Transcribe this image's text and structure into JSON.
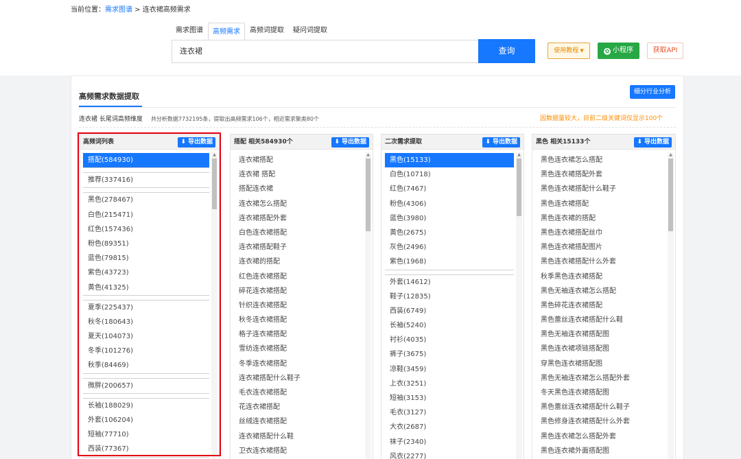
{
  "breadcrumb": {
    "prefix": "当前位置：",
    "link": "需求图谱",
    "sep": " > ",
    "current": "连衣裙高频需求"
  },
  "tabs": [
    "需求图谱",
    "高频需求",
    "高频词提取",
    "疑问词提取"
  ],
  "active_tab": 1,
  "search": {
    "value": "连衣裙",
    "button": "查询"
  },
  "actions": {
    "tutorial": "使用教程",
    "mini_program": "小程序",
    "api": "获取API"
  },
  "panel": {
    "title": "高频需求数据提取",
    "industry_button": "细分行业分析",
    "summary_left": "连衣裙 长尾词高频维度",
    "summary_stats": "共分析数据7732195条，提取出高频需求106个，相近需求聚类80个",
    "summary_right": "因数据量较大，目前二级关键词仅显示100个",
    "export_label": "导出数据"
  },
  "columns": [
    {
      "header": "高频词列表",
      "groups": [
        [
          "搭配(584930)"
        ],
        [
          "推荐(337416)"
        ],
        [
          "黑色(278467)",
          "白色(215471)",
          "红色(157436)",
          "粉色(89351)",
          "蓝色(79815)",
          "紫色(43723)",
          "黄色(41325)"
        ],
        [
          "夏季(225437)",
          "秋冬(180643)",
          "夏天(104073)",
          "冬季(101276)",
          "秋季(84469)"
        ],
        [
          "微胖(200657)"
        ],
        [
          "长袖(188029)",
          "外套(106204)",
          "短袖(77710)",
          "西装(77367)"
        ]
      ]
    },
    {
      "header": "搭配 相关584930个",
      "items": [
        "连衣裙搭配",
        "连衣裙 搭配",
        "搭配连衣裙",
        "连衣裙怎么搭配",
        "连衣裙搭配外套",
        "白色连衣裙搭配",
        "连衣裙搭配鞋子",
        "连衣裙的搭配",
        "红色连衣裙搭配",
        "碎花连衣裙搭配",
        "针织连衣裙搭配",
        "秋冬连衣裙搭配",
        "格子连衣裙搭配",
        "雪纺连衣裙搭配",
        "冬季连衣裙搭配",
        "连衣裙搭配什么鞋子",
        "毛衣连衣裙搭配",
        "花连衣裙搭配",
        "丝绒连衣裙搭配",
        "连衣裙搭配什么鞋",
        "卫衣连衣裙搭配"
      ]
    },
    {
      "header": "二次需求提取",
      "groups": [
        [
          "黑色(15133)",
          "白色(10718)",
          "红色(7467)",
          "粉色(4306)",
          "蓝色(3980)",
          "黄色(2675)",
          "灰色(2496)",
          "紫色(1968)"
        ],
        [
          "外套(14612)",
          "鞋子(12835)",
          "西装(6749)",
          "长袖(5240)",
          "衬衫(4035)",
          "裤子(3675)",
          "凉鞋(3459)",
          "上衣(3251)",
          "短袖(3153)",
          "毛衣(3127)",
          "大衣(2687)",
          "袜子(2340)",
          "风衣(2277)"
        ]
      ]
    },
    {
      "header": "黑色 相关15133个",
      "items": [
        "黑色连衣裙怎么搭配",
        "黑色连衣裙搭配外套",
        "黑色连衣裙搭配什么鞋子",
        "黑色连衣裙搭配",
        "黑色连衣裙的搭配",
        "黑色连衣裙搭配丝巾",
        "黑色连衣裙搭配图片",
        "黑色连衣裙搭配什么外套",
        "秋季黑色连衣裙搭配",
        "黑色无袖连衣裙怎么搭配",
        "黑色碎花连衣裙搭配",
        "黑色蕾丝连衣裙搭配什么鞋",
        "黑色无袖连衣裙搭配图",
        "黑色连衣裙项链搭配图",
        "穿黑色连衣裙搭配图",
        "黑色无袖连衣裙怎么搭配外套",
        "冬天黑色连衣裙搭配图",
        "黑色蕾丝连衣裙搭配什么鞋子",
        "黑色修身连衣裙搭配什么外套",
        "黑色连衣裙怎么搭配外套",
        "黑色连衣裙外面搭配图"
      ]
    }
  ]
}
